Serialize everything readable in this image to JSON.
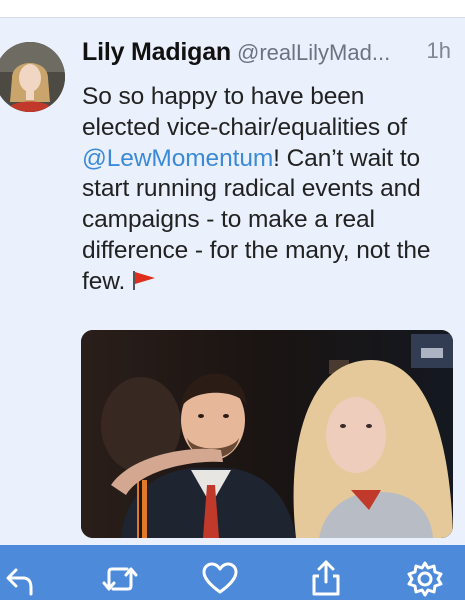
{
  "tweet": {
    "display_name": "Lily Madigan",
    "handle": "@realLilyMad...",
    "timestamp": "1h",
    "text_before_mention": "So so happy to have been elected vice-chair/equalities of ",
    "mention": "@LewMomentum",
    "text_after_mention": "! Can’t wait to start running radical events and campaigns - to make a real difference - for the many, not the few.",
    "emoji": "red-flag",
    "has_photo": true
  },
  "actions": [
    {
      "name": "reply",
      "icon": "reply-icon"
    },
    {
      "name": "retweet",
      "icon": "retweet-icon"
    },
    {
      "name": "like",
      "icon": "heart-icon"
    },
    {
      "name": "share",
      "icon": "share-icon"
    },
    {
      "name": "settings",
      "icon": "gear-icon"
    }
  ],
  "colors": {
    "accent": "#4d8ada",
    "mention": "#3b8ad8",
    "background": "#ebf1fc",
    "flag": "#e02e1e"
  }
}
